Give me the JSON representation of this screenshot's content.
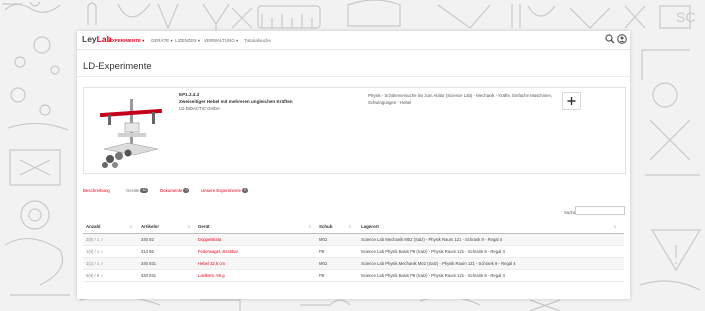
{
  "brand": {
    "ley": "Ley",
    "lab": "Lab"
  },
  "nav": {
    "items": [
      {
        "label": "EXPERIMENTE ▾",
        "active": true
      },
      {
        "label": "GERÄTE ▾",
        "active": false
      },
      {
        "label": "LIZENZEN ▾",
        "active": false
      },
      {
        "label": "VERWALTUNG ▾",
        "active": false
      },
      {
        "label": "Tutorialsuche",
        "active": false
      }
    ],
    "icons": [
      "search-icon",
      "user-circle-icon"
    ]
  },
  "page": {
    "title": "LD-Experimente"
  },
  "experiment": {
    "article_no": "EP1.2.4.3",
    "title": "Zweiseitiger Hebel mit mehreren ungleichen Kräften",
    "publisher": "LD DIDACTIC GmbH",
    "category": "Physik - Schülerversuche bis zum Abitur (Science Lab) - Mechanik - Kräfte, Einfache Maschinen, Schwingungen - Hebel",
    "add_button_icon": "plus-icon"
  },
  "tabs": [
    {
      "label": "Beschreibung",
      "badge": ""
    },
    {
      "label": "Geräte",
      "badge": "12"
    },
    {
      "label": "Dokumente",
      "badge": "0"
    },
    {
      "label": "Unsere Experimente",
      "badge": "0"
    }
  ],
  "search": {
    "label": "Suche:",
    "value": ""
  },
  "table": {
    "columns": [
      "Anzahl",
      "Artikelnr",
      "Gerät",
      "Schub",
      "Lagerort"
    ],
    "rows": [
      {
        "qty": "2(0) / 1",
        "art": "340 82",
        "device": "Doppelskala",
        "schub": "M02",
        "lager": "Science Lab Mechanik M02 (Satz) - Physik Raum 121 - Schrank 9 - Regal 4"
      },
      {
        "qty": "1(0) / 1",
        "art": "314 56",
        "device": "Federwagel, steckbar",
        "schub": "P8",
        "lager": "Science Lab Physik Basis P8 (Satz) - Physik Raum 121 - Schrank 9 - Regal 4"
      },
      {
        "qty": "1(1) / 1",
        "art": "340 831",
        "device": "Hebel 32,5 cm",
        "schub": "M02",
        "lager": "Science Lab Physik Mechanik M02 (Satz) - Physik Raum 121 - Schrank 9 - Regal 4"
      },
      {
        "qty": "6(0) / 6",
        "art": "340 831",
        "device": "Lastkörn, 50 g",
        "schub": "P8",
        "lager": "Science Lab Physik Basis P8 (Satz) - Physik Raum 121 - Schrank 9 - Regal 4"
      }
    ]
  },
  "colors": {
    "accent": "#e2001a",
    "check": "#6ab04c"
  }
}
